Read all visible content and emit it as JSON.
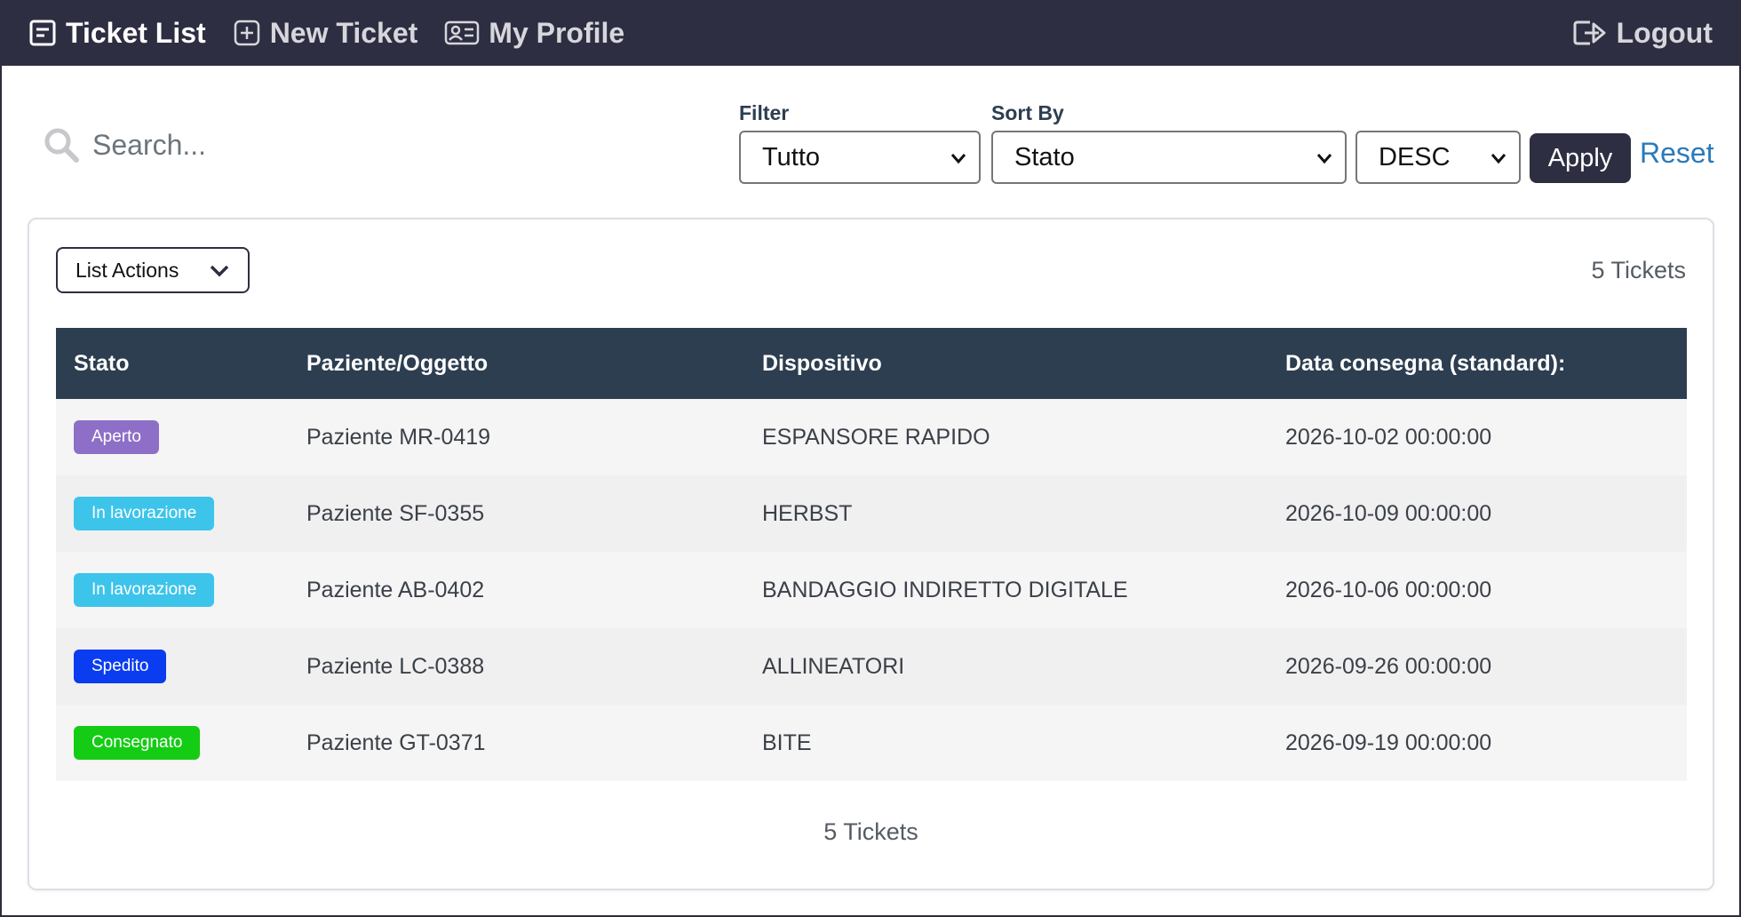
{
  "navbar": {
    "ticket_list": "Ticket List",
    "new_ticket": "New Ticket",
    "my_profile": "My Profile",
    "logout": "Logout"
  },
  "search": {
    "placeholder": "Search..."
  },
  "filter": {
    "label": "Filter",
    "selected": "Tutto"
  },
  "sort": {
    "label": "Sort By",
    "selected": "Stato",
    "order": "DESC"
  },
  "actions": {
    "apply": "Apply",
    "reset": "Reset",
    "list_actions": "List Actions"
  },
  "ticket_count": "5 Tickets",
  "table": {
    "headers": [
      "Stato",
      "Paziente/Oggetto",
      "Dispositivo",
      "Data consegna (standard):"
    ],
    "rows": [
      {
        "status": "Aperto",
        "status_color": "#8e6fc7",
        "patient": "Paziente MR-0419",
        "device": "ESPANSORE RAPIDO",
        "date": "2026-10-02 00:00:00"
      },
      {
        "status": "In lavorazione",
        "status_color": "#3dc4ea",
        "patient": "Paziente SF-0355",
        "device": "HERBST",
        "date": "2026-10-09 00:00:00"
      },
      {
        "status": "In lavorazione",
        "status_color": "#3dc4ea",
        "patient": "Paziente AB-0402",
        "device": "BANDAGGIO INDIRETTO DIGITALE",
        "date": "2026-10-06 00:00:00"
      },
      {
        "status": "Spedito",
        "status_color": "#0a3cf0",
        "patient": "Paziente LC-0388",
        "device": "ALLINEATORI",
        "date": "2026-09-26 00:00:00"
      },
      {
        "status": "Consegnato",
        "status_color": "#14cc14",
        "patient": "Paziente GT-0371",
        "device": "BITE",
        "date": "2026-09-19 00:00:00"
      }
    ]
  },
  "icons": {
    "ticket_list": "list-icon",
    "new_ticket": "plus-square-icon",
    "my_profile": "id-card-icon",
    "logout": "logout-icon",
    "search": "search-icon"
  },
  "colors": {
    "navbar_bg": "#2e2e42",
    "table_header_bg": "#2c3e50",
    "reset_link": "#2a7ab9"
  }
}
